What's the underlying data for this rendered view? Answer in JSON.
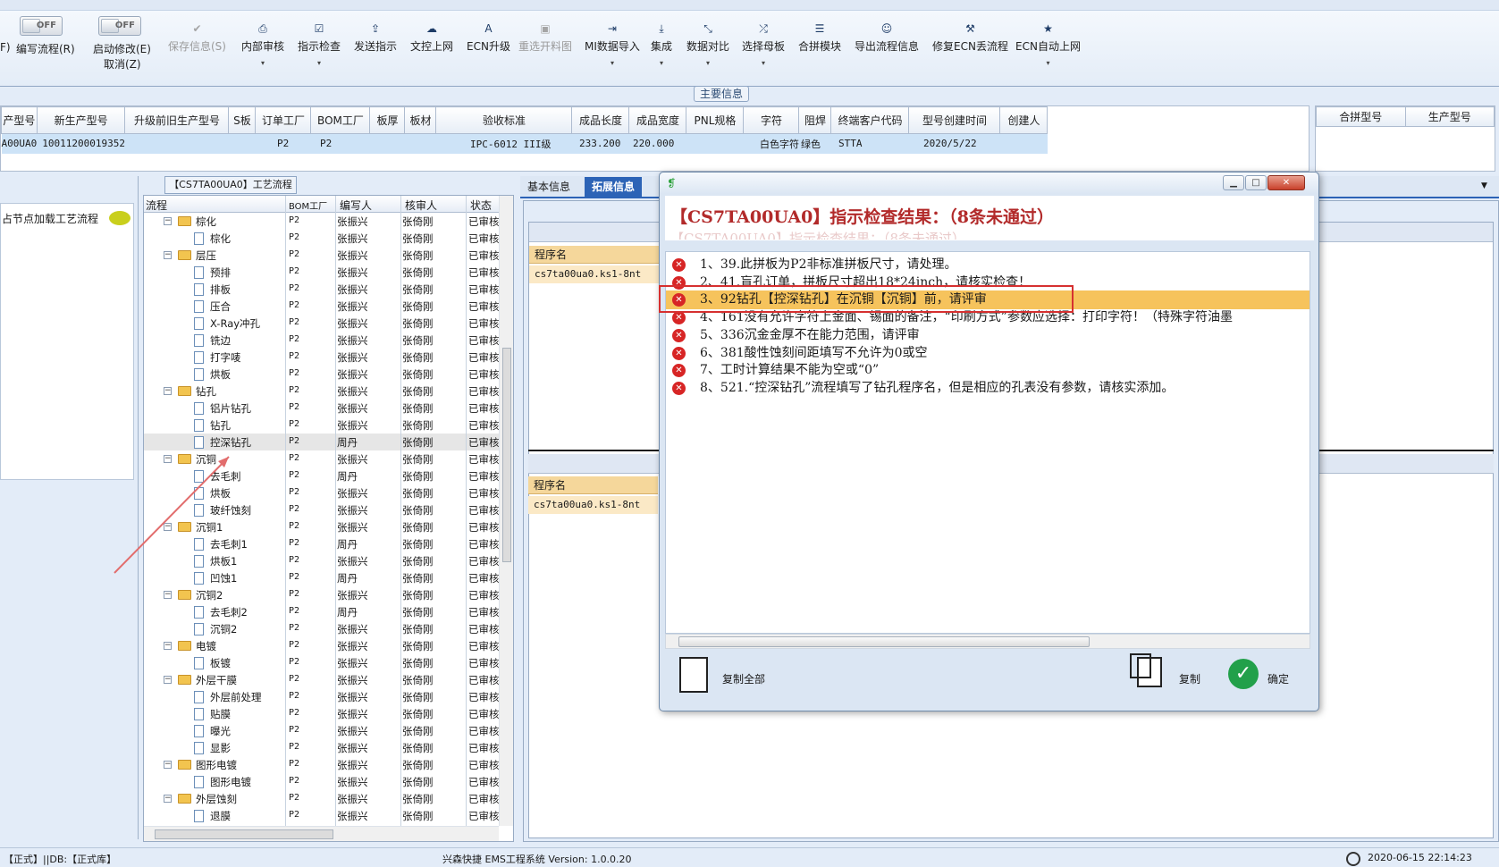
{
  "toolbar": {
    "toggle1": {
      "state": "OFF",
      "label": "编写流程(R)",
      "label_prefix": "F)"
    },
    "toggle2": {
      "state": "OFF",
      "label": "启动修改(E)",
      "label2": "取消(Z)"
    },
    "buttons": [
      {
        "label": "保存信息(S)",
        "icon": "check-icon",
        "disabled": true,
        "dropdown": false
      },
      {
        "label": "内部审核",
        "icon": "printer-icon",
        "disabled": false,
        "dropdown": true
      },
      {
        "label": "指示检查",
        "icon": "checkbox-icon",
        "disabled": false,
        "dropdown": true
      },
      {
        "label": "发送指示",
        "icon": "upload-icon",
        "disabled": false,
        "dropdown": false
      },
      {
        "label": "文控上网",
        "icon": "cloud-upload-icon",
        "disabled": false,
        "dropdown": false
      },
      {
        "label": "ECN升级",
        "icon": "font-icon",
        "disabled": false,
        "dropdown": false
      },
      {
        "label": "重选开料图",
        "icon": "image-icon",
        "disabled": true,
        "dropdown": false
      },
      {
        "label": "MI数据导入",
        "icon": "import-icon",
        "disabled": false,
        "dropdown": true
      },
      {
        "label": "集成",
        "icon": "download-icon",
        "disabled": false,
        "dropdown": true
      },
      {
        "label": "数据对比",
        "icon": "compress-icon",
        "disabled": false,
        "dropdown": true
      },
      {
        "label": "选择母板",
        "icon": "shuffle-icon",
        "disabled": false,
        "dropdown": true
      },
      {
        "label": "合拼模块",
        "icon": "list-icon",
        "disabled": false,
        "dropdown": false
      },
      {
        "label": "导出流程信息",
        "icon": "smile-icon",
        "disabled": false,
        "dropdown": false
      },
      {
        "label": "修复ECN丢流程",
        "icon": "wrench-icon",
        "disabled": false,
        "dropdown": false
      },
      {
        "label": "ECN自动上网",
        "icon": "star-icon",
        "disabled": false,
        "dropdown": true
      }
    ]
  },
  "main_info_label": "主要信息",
  "main_table": {
    "headers": [
      "产型号",
      "新生产型号",
      "升级前旧生产型号",
      "S板",
      "订单工厂",
      "BOM工厂",
      "板厚",
      "板材",
      "验收标准",
      "成品长度",
      "成品宽度",
      "PNL规格",
      "字符",
      "阻焊",
      "终端客户代码",
      "型号创建时间",
      "创建人"
    ],
    "row": [
      "A00UA0",
      "10011200019352",
      "",
      "",
      "P2",
      "P2",
      "",
      "",
      "IPC-6012 III级",
      "233.200",
      "220.000",
      "",
      "白色字符",
      "绿色",
      "STTA",
      "2020/5/22",
      ""
    ]
  },
  "merge_table": {
    "headers": [
      "合拼型号",
      "生产型号"
    ]
  },
  "left_panel": {
    "node_label": "占节点加载工艺流程"
  },
  "tree": {
    "title": "【CS7TA00UA0】工艺流程",
    "headers": [
      "流程",
      "BOM工厂",
      "编写人",
      "核审人",
      "状态"
    ],
    "rows": [
      {
        "level": 1,
        "type": "folder",
        "name": "棕化",
        "bom": "P2",
        "author": "张振兴",
        "reviewer": "张倚刚",
        "status": "已审核"
      },
      {
        "level": 2,
        "type": "file",
        "name": "棕化",
        "bom": "P2",
        "author": "张振兴",
        "reviewer": "张倚刚",
        "status": "已审核"
      },
      {
        "level": 1,
        "type": "folder",
        "name": "层压",
        "bom": "P2",
        "author": "张振兴",
        "reviewer": "张倚刚",
        "status": "已审核"
      },
      {
        "level": 2,
        "type": "file",
        "name": "预排",
        "bom": "P2",
        "author": "张振兴",
        "reviewer": "张倚刚",
        "status": "已审核"
      },
      {
        "level": 2,
        "type": "file",
        "name": "排板",
        "bom": "P2",
        "author": "张振兴",
        "reviewer": "张倚刚",
        "status": "已审核"
      },
      {
        "level": 2,
        "type": "file",
        "name": "压合",
        "bom": "P2",
        "author": "张振兴",
        "reviewer": "张倚刚",
        "status": "已审核"
      },
      {
        "level": 2,
        "type": "file",
        "name": "X-Ray冲孔",
        "bom": "P2",
        "author": "张振兴",
        "reviewer": "张倚刚",
        "status": "已审核"
      },
      {
        "level": 2,
        "type": "file",
        "name": "铣边",
        "bom": "P2",
        "author": "张振兴",
        "reviewer": "张倚刚",
        "status": "已审核"
      },
      {
        "level": 2,
        "type": "file",
        "name": "打字唛",
        "bom": "P2",
        "author": "张振兴",
        "reviewer": "张倚刚",
        "status": "已审核"
      },
      {
        "level": 2,
        "type": "file",
        "name": "烘板",
        "bom": "P2",
        "author": "张振兴",
        "reviewer": "张倚刚",
        "status": "已审核"
      },
      {
        "level": 1,
        "type": "folder",
        "name": "钻孔",
        "bom": "P2",
        "author": "张振兴",
        "reviewer": "张倚刚",
        "status": "已审核"
      },
      {
        "level": 2,
        "type": "file",
        "name": "铝片钻孔",
        "bom": "P2",
        "author": "张振兴",
        "reviewer": "张倚刚",
        "status": "已审核"
      },
      {
        "level": 2,
        "type": "file",
        "name": "钻孔",
        "bom": "P2",
        "author": "张振兴",
        "reviewer": "张倚刚",
        "status": "已审核"
      },
      {
        "level": 2,
        "type": "file",
        "name": "控深钻孔",
        "bom": "P2",
        "author": "周丹",
        "reviewer": "张倚刚",
        "status": "已审核",
        "highlight": true
      },
      {
        "level": 1,
        "type": "folder",
        "name": "沉铜",
        "bom": "P2",
        "author": "张振兴",
        "reviewer": "张倚刚",
        "status": "已审核"
      },
      {
        "level": 2,
        "type": "file",
        "name": "去毛刺",
        "bom": "P2",
        "author": "周丹",
        "reviewer": "张倚刚",
        "status": "已审核"
      },
      {
        "level": 2,
        "type": "file",
        "name": "烘板",
        "bom": "P2",
        "author": "张振兴",
        "reviewer": "张倚刚",
        "status": "已审核"
      },
      {
        "level": 2,
        "type": "file",
        "name": "玻纤蚀刻",
        "bom": "P2",
        "author": "张振兴",
        "reviewer": "张倚刚",
        "status": "已审核"
      },
      {
        "level": 1,
        "type": "folder",
        "name": "沉铜1",
        "bom": "P2",
        "author": "张振兴",
        "reviewer": "张倚刚",
        "status": "已审核"
      },
      {
        "level": 2,
        "type": "file",
        "name": "去毛刺1",
        "bom": "P2",
        "author": "周丹",
        "reviewer": "张倚刚",
        "status": "已审核"
      },
      {
        "level": 2,
        "type": "file",
        "name": "烘板1",
        "bom": "P2",
        "author": "张振兴",
        "reviewer": "张倚刚",
        "status": "已审核"
      },
      {
        "level": 2,
        "type": "file",
        "name": "凹蚀1",
        "bom": "P2",
        "author": "周丹",
        "reviewer": "张倚刚",
        "status": "已审核"
      },
      {
        "level": 1,
        "type": "folder",
        "name": "沉铜2",
        "bom": "P2",
        "author": "张振兴",
        "reviewer": "张倚刚",
        "status": "已审核"
      },
      {
        "level": 2,
        "type": "file",
        "name": "去毛刺2",
        "bom": "P2",
        "author": "周丹",
        "reviewer": "张倚刚",
        "status": "已审核"
      },
      {
        "level": 2,
        "type": "file",
        "name": "沉铜2",
        "bom": "P2",
        "author": "张振兴",
        "reviewer": "张倚刚",
        "status": "已审核"
      },
      {
        "level": 1,
        "type": "folder",
        "name": "电镀",
        "bom": "P2",
        "author": "张振兴",
        "reviewer": "张倚刚",
        "status": "已审核"
      },
      {
        "level": 2,
        "type": "file",
        "name": "板镀",
        "bom": "P2",
        "author": "张振兴",
        "reviewer": "张倚刚",
        "status": "已审核"
      },
      {
        "level": 1,
        "type": "folder",
        "name": "外层干膜",
        "bom": "P2",
        "author": "张振兴",
        "reviewer": "张倚刚",
        "status": "已审核"
      },
      {
        "level": 2,
        "type": "file",
        "name": "外层前处理",
        "bom": "P2",
        "author": "张振兴",
        "reviewer": "张倚刚",
        "status": "已审核"
      },
      {
        "level": 2,
        "type": "file",
        "name": "贴膜",
        "bom": "P2",
        "author": "张振兴",
        "reviewer": "张倚刚",
        "status": "已审核"
      },
      {
        "level": 2,
        "type": "file",
        "name": "曝光",
        "bom": "P2",
        "author": "张振兴",
        "reviewer": "张倚刚",
        "status": "已审核"
      },
      {
        "level": 2,
        "type": "file",
        "name": "显影",
        "bom": "P2",
        "author": "张振兴",
        "reviewer": "张倚刚",
        "status": "已审核"
      },
      {
        "level": 1,
        "type": "folder",
        "name": "图形电镀",
        "bom": "P2",
        "author": "张振兴",
        "reviewer": "张倚刚",
        "status": "已审核"
      },
      {
        "level": 2,
        "type": "file",
        "name": "图形电镀",
        "bom": "P2",
        "author": "张振兴",
        "reviewer": "张倚刚",
        "status": "已审核"
      },
      {
        "level": 1,
        "type": "folder",
        "name": "外层蚀刻",
        "bom": "P2",
        "author": "张振兴",
        "reviewer": "张倚刚",
        "status": "已审核"
      },
      {
        "level": 2,
        "type": "file",
        "name": "退膜",
        "bom": "P2",
        "author": "张振兴",
        "reviewer": "张倚刚",
        "status": "已审核"
      }
    ]
  },
  "right_tabs": [
    {
      "label": "基本信息",
      "active": false
    },
    {
      "label": "拓展信息",
      "active": true
    }
  ],
  "right_panel": {
    "upper": {
      "header": "程序名",
      "value": "cs7ta00ua0.ks1-8nt"
    },
    "lower": {
      "header": "程序名",
      "value": "cs7ta00ua0.ks1-8nt"
    }
  },
  "dialog": {
    "title_icon": "app-logo-icon",
    "header": "【CS7TA00UA0】指示检查结果：（8条未通过）",
    "header_reflection": "【CS7TA00UA0】指示检查结果：（8条未通过）",
    "messages": [
      "1、39.此拼板为P2非标准拼板尺寸，请处理。",
      "2、41.盲孔订单，拼板尺寸超出18*24inch，请核实检查！",
      "3、92钻孔【控深钻孔】在沉铜【沉铜】前，请评审",
      "4、161没有允许字符上金面、锡面的备注，“印刷方式”参数应选择：打印字符！（特殊字符油墨",
      "5、336沉金金厚不在能力范围，请评审",
      "6、381酸性蚀刻间距填写不允许为0或空",
      "7、工时计算结果不能为空或“0”",
      "8、521.“控深钻孔”流程填写了钻孔程序名，但是相应的孔表没有参数，请核实添加。"
    ],
    "selected_index": 2,
    "copy_all_label": "复制全部",
    "copy_label": "复制",
    "ok_label": "确定"
  },
  "statusbar": {
    "left": "【正式】||DB:【正式库】",
    "center": "兴森快捷 EMS工程系统 Version: 1.0.0.20",
    "datetime": "2020-06-15 22:14:23"
  },
  "colors": {
    "accent": "#2c63b6",
    "error": "#d72525",
    "selected_row": "#f6c35c",
    "header_red": "#b22a2a"
  }
}
